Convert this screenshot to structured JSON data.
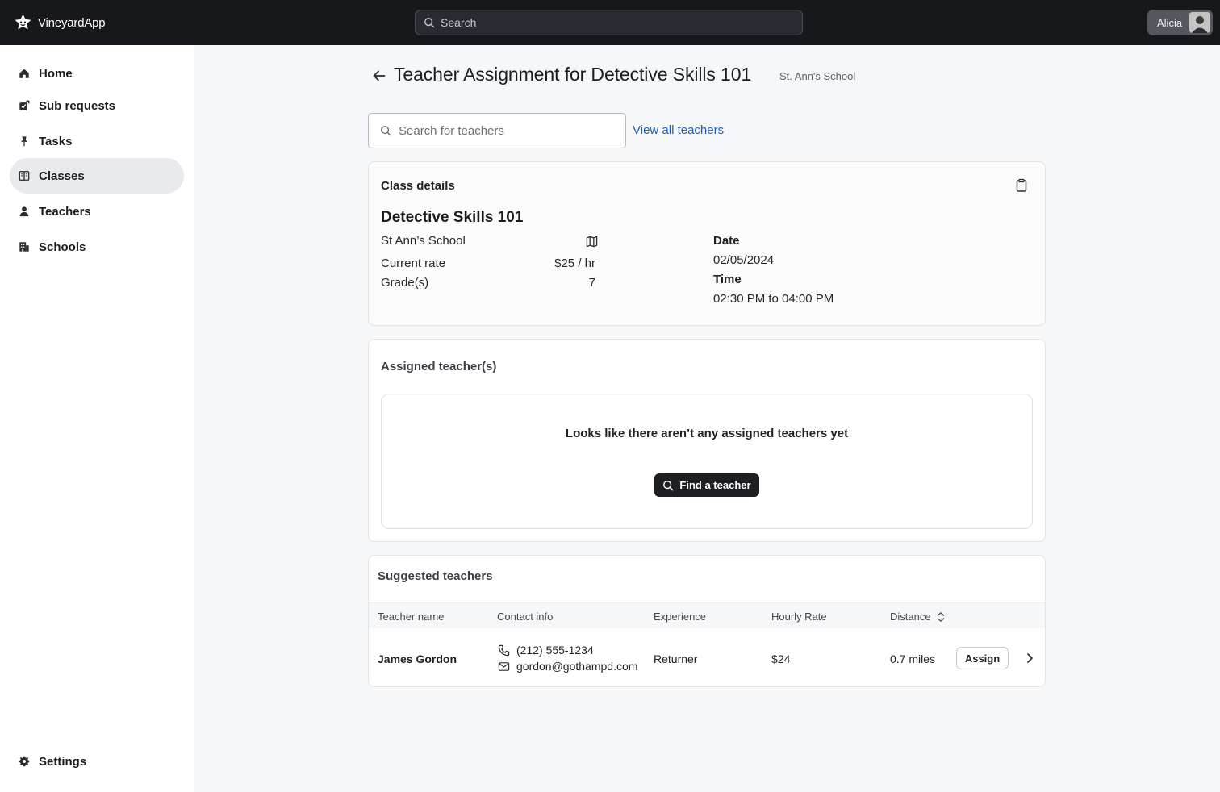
{
  "topbar": {
    "app_name": "VineyardApp",
    "search_placeholder": "Search",
    "user_name": "Alicia"
  },
  "sidebar": {
    "items": [
      {
        "label": "Home",
        "icon": "home-icon",
        "active": false
      },
      {
        "label": "Sub requests",
        "icon": "sub-requests-icon",
        "active": false
      },
      {
        "label": "Tasks",
        "icon": "pin-icon",
        "active": false
      },
      {
        "label": "Classes",
        "icon": "book-icon",
        "active": true
      },
      {
        "label": "Teachers",
        "icon": "person-icon",
        "active": false
      },
      {
        "label": "Schools",
        "icon": "building-icon",
        "active": false
      }
    ],
    "settings_label": "Settings"
  },
  "page": {
    "title": "Teacher Assignment for Detective Skills 101",
    "subtitle": "St. Ann's School",
    "search_placeholder": "Search for teachers",
    "view_all_label": "View all teachers"
  },
  "class_details": {
    "heading": "Class details",
    "class_name": "Detective Skills 101",
    "school": "St Ann’s School",
    "rate_label": "Current rate",
    "rate_value": "$25 / hr",
    "grade_label": "Grade(s)",
    "grade_value": "7",
    "date_label": "Date",
    "date_value": "02/05/2024",
    "time_label": "Time",
    "time_value": "02:30 PM to 04:00 PM"
  },
  "assigned": {
    "heading": "Assigned teacher(s)",
    "empty_message": "Looks like there aren’t any assigned teachers yet",
    "find_button": "Find a teacher"
  },
  "suggested": {
    "heading": "Suggested teachers",
    "columns": [
      "Teacher name",
      "Contact info",
      "Experience",
      "Hourly Rate",
      "Distance"
    ],
    "rows": [
      {
        "name": "James Gordon",
        "phone": "(212) 555-1234",
        "email": "gordon@gothampd.com",
        "experience": "Returner",
        "rate": "$24",
        "distance": "0.7 miles",
        "action": "Assign"
      }
    ]
  },
  "colors": {
    "topbar_bg": "#17181b",
    "link": "#1f5fb8",
    "active_nav_bg": "#e9eaed",
    "primary_button": "#1d1f23"
  }
}
